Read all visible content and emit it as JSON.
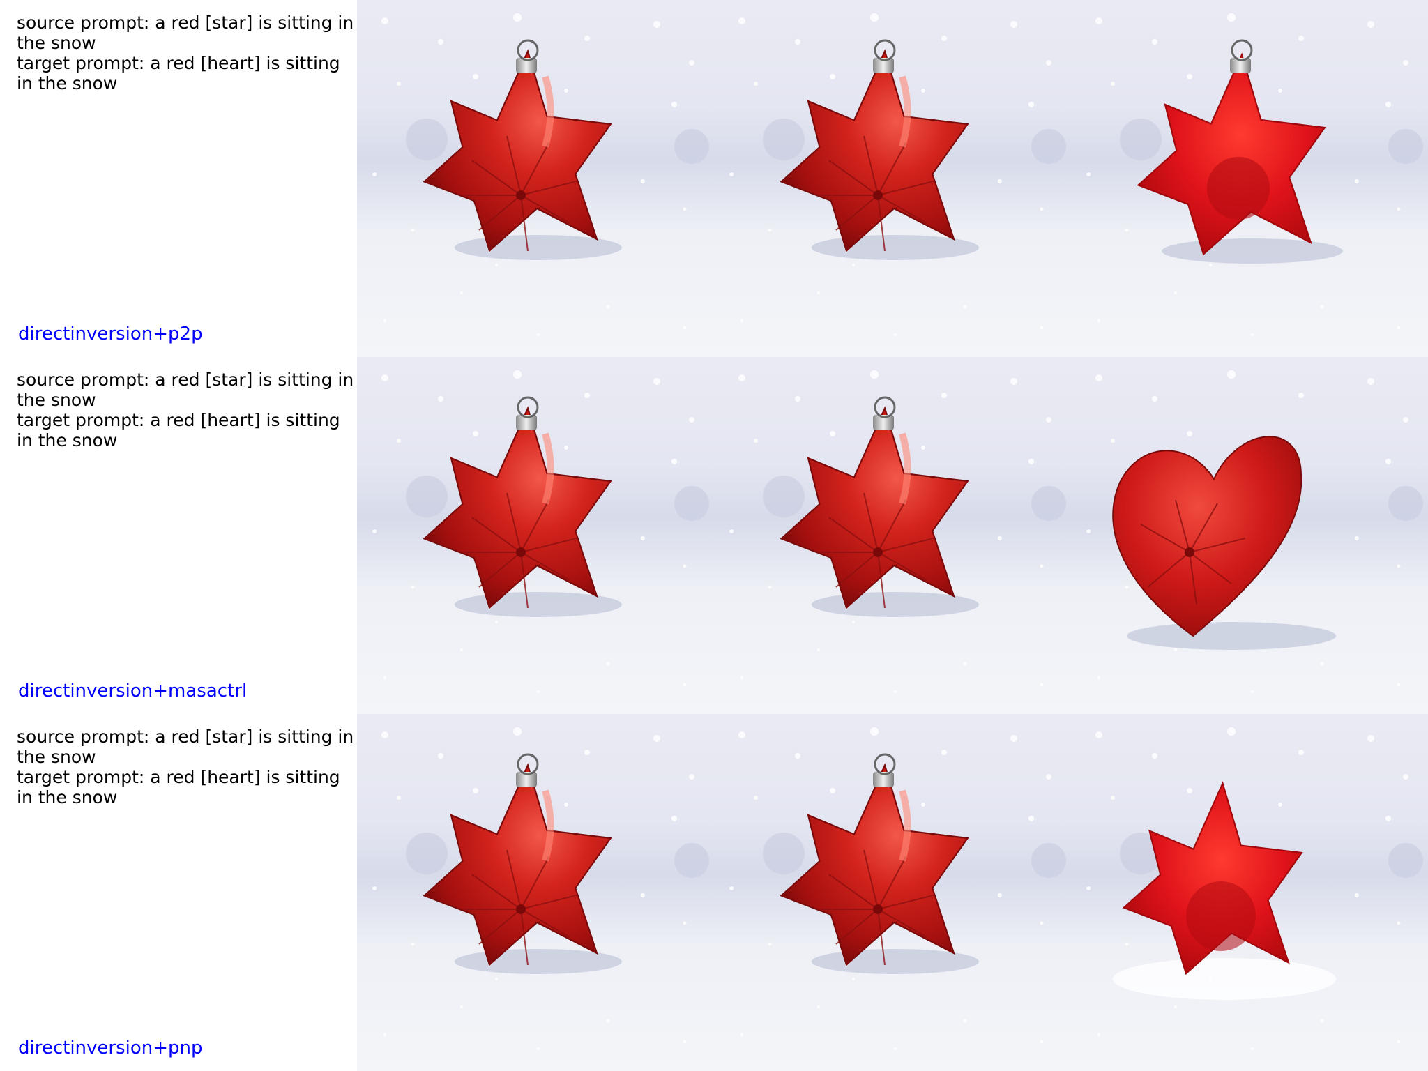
{
  "rows": [
    {
      "source_prompt": "source prompt: a red [star] is sitting in the snow",
      "target_prompt": "target prompt: a red [heart] is sitting in the snow",
      "method": "directinversion+p2p",
      "images": [
        "star-ornament",
        "star-ornament",
        "star-ornament-bright"
      ]
    },
    {
      "source_prompt": "source prompt: a red [star] is sitting in the snow",
      "target_prompt": "target prompt: a red [heart] is sitting in the snow",
      "method": "directinversion+masactrl",
      "images": [
        "star-ornament",
        "star-ornament",
        "heart-ornament"
      ]
    },
    {
      "source_prompt": "source prompt: a red [star] is sitting in the snow",
      "target_prompt": "target prompt: a red [heart] is sitting in the snow",
      "method": "directinversion+pnp",
      "images": [
        "star-ornament",
        "star-ornament",
        "star-ornament-melted"
      ]
    }
  ],
  "colors": {
    "method_label": "#0000ff",
    "ornament_red": "#c8141c",
    "snow": "#eef0f6"
  }
}
